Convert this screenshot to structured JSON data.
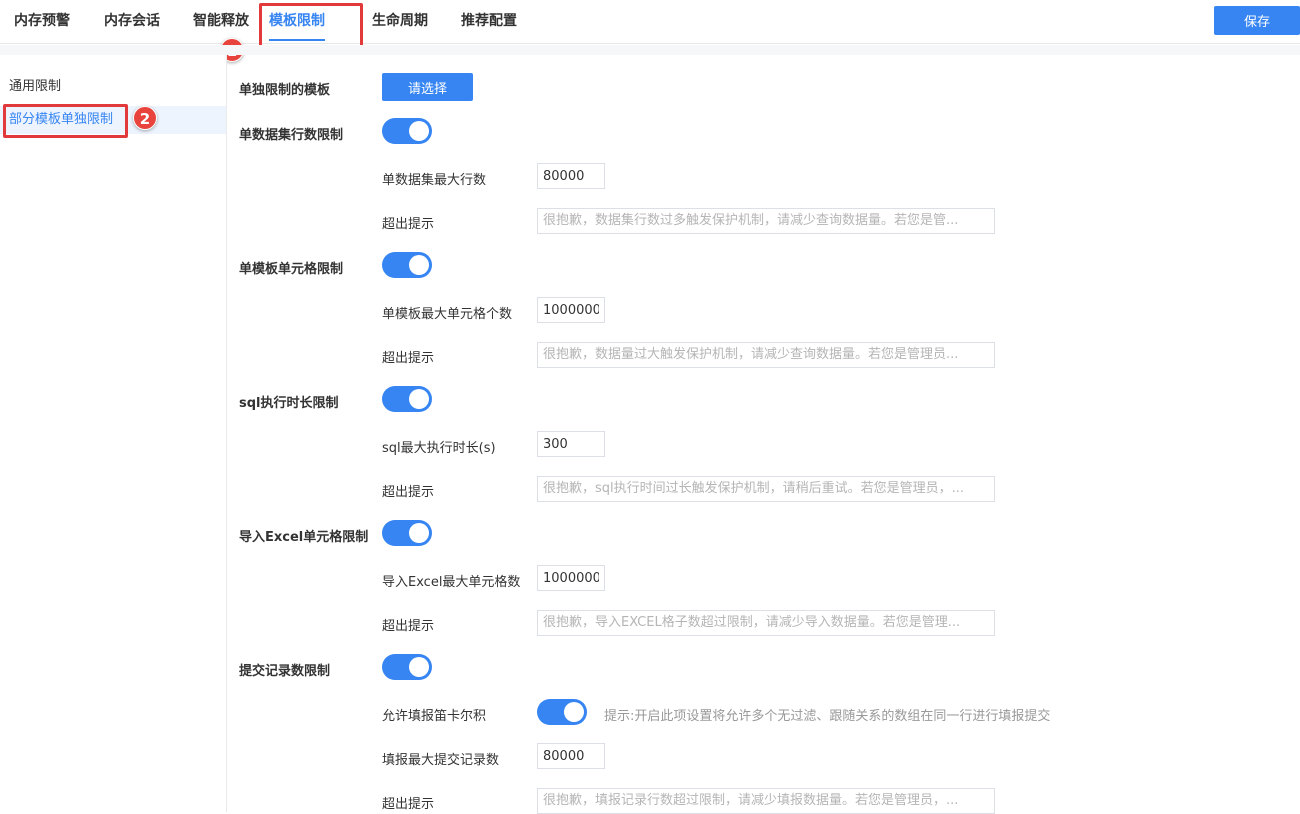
{
  "tabs": [
    {
      "label": "内存预警"
    },
    {
      "label": "内存会话"
    },
    {
      "label": "智能释放"
    },
    {
      "label": "模板限制"
    },
    {
      "label": "生命周期"
    },
    {
      "label": "推荐配置"
    }
  ],
  "active_tab": "模板限制",
  "save_label": "保存",
  "annotations": {
    "badge1": "1",
    "badge2": "2"
  },
  "sidebar": {
    "items": [
      {
        "label": "通用限制"
      },
      {
        "label": "部分模板单独限制"
      }
    ]
  },
  "main": {
    "template_label": "单独限制的模板",
    "choose_label": "请选择",
    "sections": [
      {
        "label": "单数据集行数限制",
        "enabled": true,
        "max_label": "单数据集最大行数",
        "max_value": "80000",
        "tip_label": "超出提示",
        "tip_placeholder": "很抱歉，数据集行数过多触发保护机制，请减少查询数据量。若您是管..."
      },
      {
        "label": "单模板单元格限制",
        "enabled": true,
        "max_label": "单模板最大单元格个数",
        "max_value": "1000000",
        "tip_label": "超出提示",
        "tip_placeholder": "很抱歉，数据量过大触发保护机制，请减少查询数据量。若您是管理员..."
      },
      {
        "label": "sql执行时长限制",
        "enabled": true,
        "max_label": "sql最大执行时长(s)",
        "max_value": "300",
        "tip_label": "超出提示",
        "tip_placeholder": "很抱歉，sql执行时间过长触发保护机制，请稍后重试。若您是管理员，..."
      },
      {
        "label": "导入Excel单元格限制",
        "enabled": true,
        "max_label": "导入Excel最大单元格数",
        "max_value": "1000000",
        "tip_label": "超出提示",
        "tip_placeholder": "很抱歉，导入EXCEL格子数超过限制，请减少导入数据量。若您是管理..."
      }
    ],
    "submit": {
      "label": "提交记录数限制",
      "enabled": true,
      "cartesian_label": "允许填报笛卡尔积",
      "cartesian_enabled": true,
      "cartesian_hint": "提示:开启此项设置将允许多个无过滤、跟随关系的数组在同一行进行填报提交",
      "max_label": "填报最大提交记录数",
      "max_value": "80000",
      "tip_label": "超出提示",
      "tip_placeholder": "很抱歉，填报记录行数超过限制，请减少填报数据量。若您是管理员，..."
    }
  },
  "colors": {
    "accent": "#3685f2",
    "annotation": "#e2393b"
  }
}
